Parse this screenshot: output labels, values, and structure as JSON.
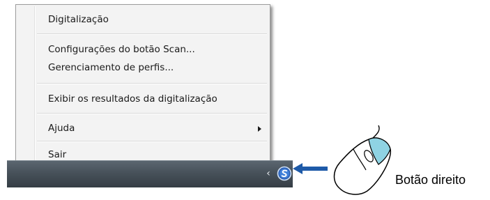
{
  "menu": {
    "items": [
      {
        "label": "Digitalização"
      },
      {
        "label": "Configurações do botão Scan..."
      },
      {
        "label": "Gerenciamento de perfis..."
      },
      {
        "label": "Exibir os resultados da digitalização"
      },
      {
        "label": "Ajuda"
      },
      {
        "label": "Sair"
      }
    ]
  },
  "taskbar": {
    "tray_chevron": "‹",
    "tray_icon": "scansnap-manager-icon"
  },
  "annotation": {
    "caption": "Botão direito",
    "arrow_color": "#1e5aa8",
    "mouse_button_color": "#8fd3e3"
  }
}
